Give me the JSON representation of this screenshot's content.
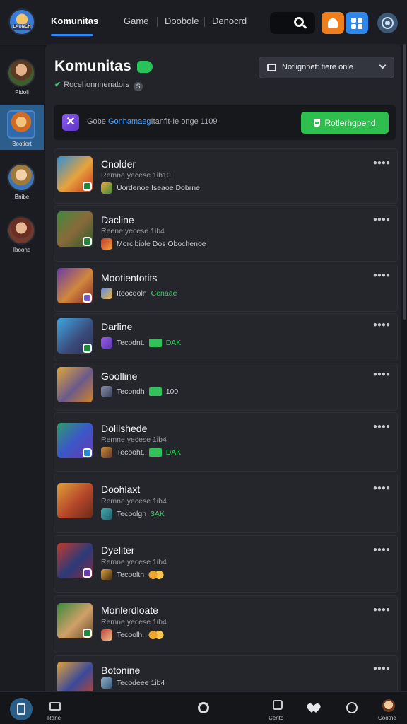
{
  "topbar": {
    "avatar_tag": "LAUNCH",
    "tabs": [
      {
        "label": "Komunitas",
        "active": true
      },
      {
        "label": "Game",
        "active": false
      },
      {
        "label": "Doobole",
        "active": false
      },
      {
        "label": "Denocrd",
        "active": false
      }
    ],
    "icons": [
      "search-icon",
      "bell-icon",
      "grid-icon",
      "profile-icon"
    ],
    "colors": {
      "accent": "#2f86f6",
      "orange": "#ee7f1c",
      "blue": "#2e88ec"
    }
  },
  "rail": {
    "items": [
      {
        "label": "Pidoli",
        "active": false
      },
      {
        "label": "Bootiert",
        "active": true
      },
      {
        "label": "Bnibe",
        "active": false
      },
      {
        "label": "Iboone",
        "active": false
      }
    ]
  },
  "main": {
    "title": "Komunitas",
    "subtitle": "Rocehonnnenators",
    "filter_label": "Notlignnet: tiere onle",
    "banner": {
      "prefix": "Gobe ",
      "highlight": "Gonhamaeg",
      "rest": "Itanfit-Ie onge 1109",
      "button_label": "Rotlerhgpend"
    },
    "rows": [
      {
        "name": "Cnolder",
        "meta": "Remne yecese 1ib10",
        "sub": "Uordenoe Iseaoe Dobrne",
        "extra": "",
        "extra_type": "none"
      },
      {
        "name": "Dacline",
        "meta": "Reene yecese 1ib4",
        "sub": "Morcibiole Dos Obochenoe",
        "extra": "",
        "extra_type": "none"
      },
      {
        "name": "Mootientotits",
        "meta": "",
        "sub": "Itoocdoln",
        "extra": "Cenaae",
        "extra_type": "green"
      },
      {
        "name": "Darline",
        "meta": "",
        "sub": "Tecodnt.",
        "extra": "DAK",
        "extra_type": "money"
      },
      {
        "name": "Goolline",
        "meta": "",
        "sub": "Tecondh",
        "extra": "100",
        "extra_type": "money-plain"
      },
      {
        "name": "Dolilshede",
        "meta": "Remne yecese 1ib4",
        "sub": "Tecooht.",
        "extra": "DAK",
        "extra_type": "money"
      },
      {
        "name": "Doohlaxt",
        "meta": "Remne yecese 1ib4",
        "sub": "Tecoolgn",
        "extra": "3AK",
        "extra_type": "green"
      },
      {
        "name": "Dyeliter",
        "meta": "Remne yecese 1ib4",
        "sub": "Tecoolth",
        "extra": "",
        "extra_type": "coin"
      },
      {
        "name": "Monlerdloate",
        "meta": "Remne yecese 1ib4",
        "sub": "Tecoolh.",
        "extra": "",
        "extra_type": "coin"
      },
      {
        "name": "Botonine",
        "meta": "",
        "sub": "Tecodeee 1ib4",
        "extra": "",
        "extra_type": "none"
      }
    ]
  },
  "bottom": {
    "left_label": "Rane",
    "items": [
      {
        "label": ""
      },
      {
        "label": ""
      },
      {
        "label": "Cento"
      },
      {
        "label": ""
      },
      {
        "label": ""
      },
      {
        "label": "Cootne"
      }
    ]
  }
}
